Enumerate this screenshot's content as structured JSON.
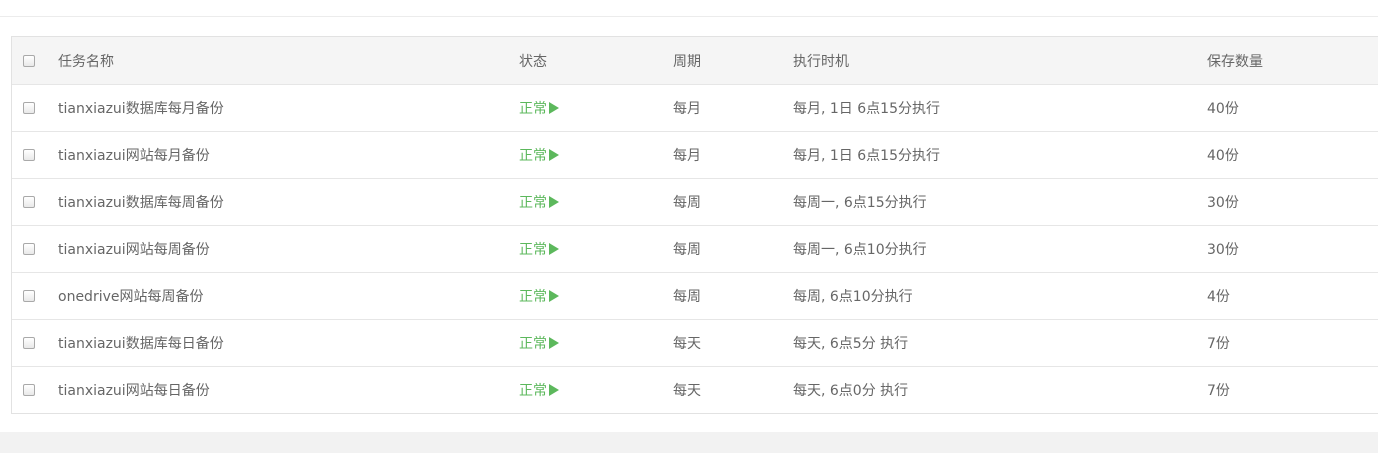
{
  "table": {
    "headers": {
      "name": "任务名称",
      "status": "状态",
      "cycle": "周期",
      "exec_time": "执行时机",
      "keep_count": "保存数量"
    },
    "rows": [
      {
        "name": "tianxiazui数据库每月备份",
        "status": "正常",
        "cycle": "每月",
        "exec_time": "每月, 1日 6点15分执行",
        "keep_count": "40份"
      },
      {
        "name": "tianxiazui网站每月备份",
        "status": "正常",
        "cycle": "每月",
        "exec_time": "每月, 1日 6点15分执行",
        "keep_count": "40份"
      },
      {
        "name": "tianxiazui数据库每周备份",
        "status": "正常",
        "cycle": "每周",
        "exec_time": "每周一, 6点15分执行",
        "keep_count": "30份"
      },
      {
        "name": "tianxiazui网站每周备份",
        "status": "正常",
        "cycle": "每周",
        "exec_time": "每周一, 6点10分执行",
        "keep_count": "30份"
      },
      {
        "name": "onedrive网站每周备份",
        "status": "正常",
        "cycle": "每周",
        "exec_time": "每周, 6点10分执行",
        "keep_count": "4份"
      },
      {
        "name": "tianxiazui数据库每日备份",
        "status": "正常",
        "cycle": "每天",
        "exec_time": "每天, 6点5分 执行",
        "keep_count": "7份"
      },
      {
        "name": "tianxiazui网站每日备份",
        "status": "正常",
        "cycle": "每天",
        "exec_time": "每天, 6点0分 执行",
        "keep_count": "7份"
      }
    ]
  },
  "icons": {
    "status": "play-icon",
    "select": "checkbox"
  },
  "colors": {
    "status_ok": "#5cb85c",
    "header_bg": "#f5f5f5",
    "text": "#666666"
  }
}
